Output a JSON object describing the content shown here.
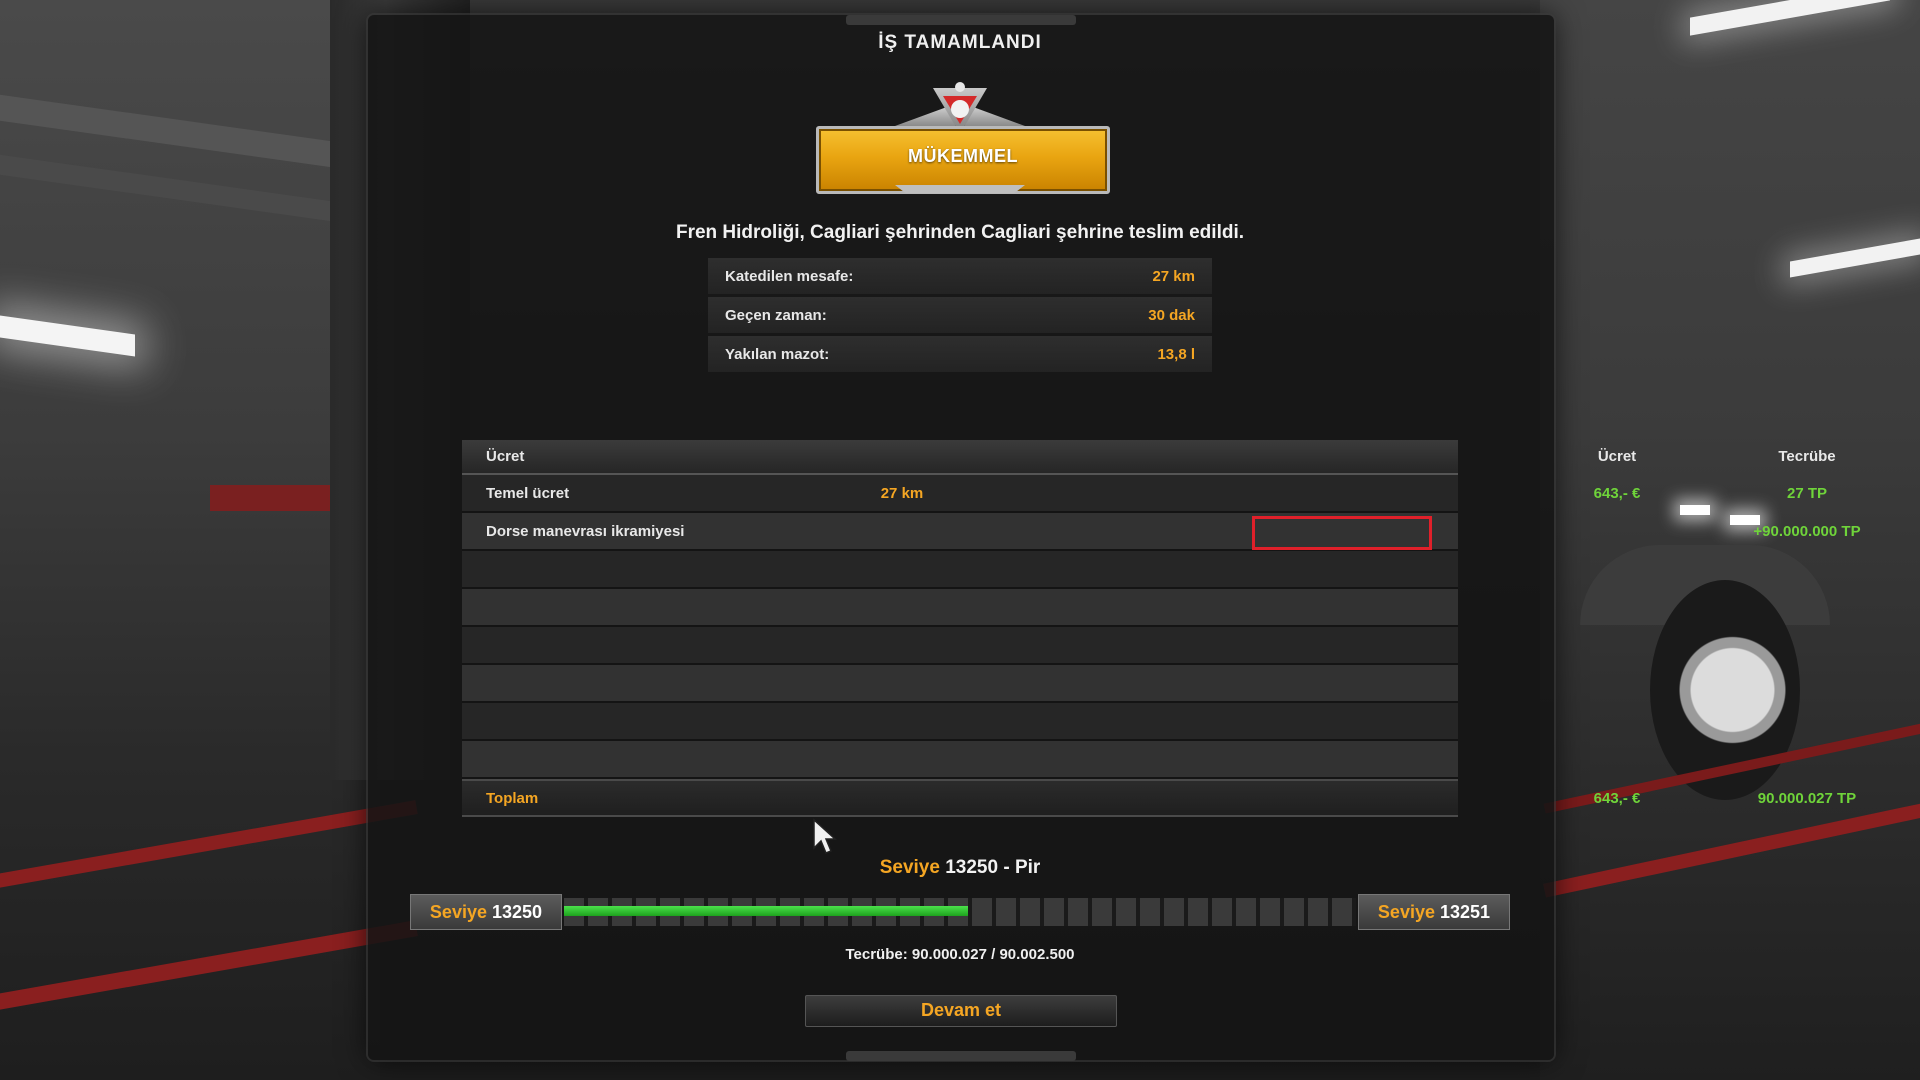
{
  "window": {
    "title": "İŞ TAMAMLANDI"
  },
  "rating": {
    "label": "MÜKEMMEL",
    "colors": {
      "badge": "#e9a511",
      "accent": "#d42a2a"
    }
  },
  "delivery_text": "Fren Hidroliği, Cagliari şehrinden Cagliari şehrine teslim edildi.",
  "stats": [
    {
      "label": "Katedilen mesafe:",
      "value": "27 km"
    },
    {
      "label": "Geçen zaman:",
      "value": "30 dak"
    },
    {
      "label": "Yakılan mazot:",
      "value": "13,8 l"
    }
  ],
  "income_table": {
    "headers": {
      "name": "Ücret",
      "pay": "Ücret",
      "exp": "Tecrübe"
    },
    "rows": [
      {
        "name": "Temel ücret",
        "distance": "27 km",
        "pay": "643,- €",
        "exp": "27 TP"
      },
      {
        "name": "Dorse manevrası ikramiyesi",
        "distance": "",
        "pay": "",
        "exp": "+90.000.000 TP"
      }
    ],
    "total": {
      "label": "Toplam",
      "pay": "643,- €",
      "exp": "90.000.027 TP"
    }
  },
  "level": {
    "title_prefix": "Seviye",
    "title_value": "13250 - Pir",
    "current_prefix": "Seviye",
    "current": "13250",
    "next_prefix": "Seviye",
    "next": "13251",
    "progress": 0.51,
    "experience_text": "Tecrübe: 90.000.027 / 90.002.500"
  },
  "buttons": {
    "continue": "Devam et"
  },
  "colors": {
    "orange": "#f5a623",
    "green": "#6fd43a",
    "highlight_border": "#e0202a"
  }
}
